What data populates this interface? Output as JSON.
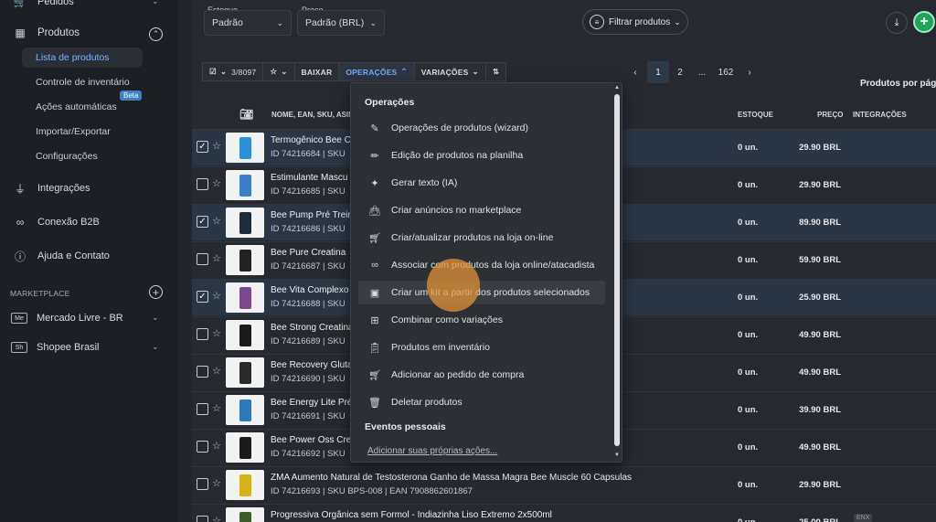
{
  "sidebar": {
    "top_item": "Pedidos",
    "produtos": "Produtos",
    "sub_items": [
      "Lista de produtos",
      "Controle de inventário",
      "Ações automáticas",
      "Importar/Exportar",
      "Configurações"
    ],
    "beta": "Beta",
    "integracoes": "Integrações",
    "conexao": "Conexão B2B",
    "ajuda": "Ajuda e Contato",
    "marketplace_title": "MARKETPLACE",
    "marketplaces": [
      {
        "badge": "Me",
        "label": "Mercado Livre - BR"
      },
      {
        "badge": "Sh",
        "label": "Shopee Brasil"
      }
    ]
  },
  "filters": {
    "estoque_label": "Estoque",
    "estoque_value": "Padrão",
    "preco_label": "Preço",
    "preco_value": "Padrão (BRL)",
    "filter_button": "Filtrar produtos"
  },
  "toolbar": {
    "selection": "3/8097",
    "baixar": "BAIXAR",
    "operacoes": "OPERAÇÕES",
    "variacoes": "VARIAÇÕES"
  },
  "pager": {
    "pages": [
      "1",
      "2",
      "...",
      "162"
    ],
    "per_page": "Produtos por pági"
  },
  "table": {
    "headers": {
      "name": "NOME, EAN, SKU, ASIN",
      "estoque": "ESTOQUE",
      "preco": "PREÇO",
      "integracoes": "INTEGRAÇÕES"
    },
    "rows": [
      {
        "name": "Termogênico Bee Co",
        "meta": "ID 74216684 | SKU",
        "stock": "0 un.",
        "price": "29.90 BRL",
        "selected": true,
        "color": "#2f8fd8"
      },
      {
        "name": "Estimulante Mascu",
        "meta": "ID 74216685 | SKU",
        "stock": "0 un.",
        "price": "29.90 BRL",
        "selected": false,
        "color": "#3a7fc7"
      },
      {
        "name": "Bee Pump Pré Trein",
        "meta": "ID 74216686 | SKU",
        "stock": "0 un.",
        "price": "89.90 BRL",
        "selected": true,
        "color": "#1d2b3a"
      },
      {
        "name": "Bee Pure Creatina",
        "meta": "ID 74216687 | SKU",
        "stock": "0 un.",
        "price": "59.90 BRL",
        "selected": false,
        "color": "#222222"
      },
      {
        "name": "Bee Vita Complexo",
        "meta": "ID 74216688 | SKU",
        "stock": "0 un.",
        "price": "25.90 BRL",
        "selected": true,
        "color": "#7a4a8a"
      },
      {
        "name": "Bee Strong Creatina",
        "meta": "ID 74216689 | SKU",
        "stock": "0 un.",
        "price": "49.90 BRL",
        "selected": false,
        "color": "#1a1a1a"
      },
      {
        "name": "Bee Recovery Gluta",
        "meta": "ID 74216690 | SKU",
        "stock": "0 un.",
        "price": "49.90 BRL",
        "selected": false,
        "color": "#2a2a2a"
      },
      {
        "name": "Bee Energy Lite Pré",
        "meta": "ID 74216691 | SKU",
        "stock": "0 un.",
        "price": "39.90 BRL",
        "selected": false,
        "color": "#2e7ab8"
      },
      {
        "name": "Bee Power Oss Cre",
        "meta": "ID 74216692 | SKU",
        "stock": "0 un.",
        "price": "49.90 BRL",
        "selected": false,
        "color": "#1b1b1b"
      },
      {
        "name": "ZMA Aumento Natural de Testosterona Ganho de Massa Magra Bee Muscle 60 Capsulas",
        "meta": "ID 74216693 | SKU BPS-008 | EAN 7908862601867",
        "stock": "0 un.",
        "price": "29.90 BRL",
        "selected": false,
        "color": "#d8b21a"
      },
      {
        "name": "Progressiva Orgânica sem Formol - Indiazinha Liso Extremo 2x500ml",
        "meta": "",
        "stock": "0 un.",
        "price": "25.00 BRL",
        "selected": false,
        "color": "#3c5a2a"
      }
    ]
  },
  "menu": {
    "section1": "Operações",
    "items": [
      {
        "icon": "pencil-icon",
        "label": "Operações de produtos (wizard)"
      },
      {
        "icon": "edit-icon",
        "label": "Edição de produtos na planilha"
      },
      {
        "icon": "sparkle-icon",
        "label": "Gerar texto (IA)"
      },
      {
        "icon": "bag-icon",
        "label": "Criar anúncios no marketplace"
      },
      {
        "icon": "cart-icon",
        "label": "Criar/atualizar produtos na loja on-line"
      },
      {
        "icon": "link-icon",
        "label": "Associar com produtos da loja online/atacadista"
      },
      {
        "icon": "kit-icon",
        "label": "Criar um kit a partir dos produtos selecionados"
      },
      {
        "icon": "grid-icon",
        "label": "Combinar como variações"
      },
      {
        "icon": "clipboard-icon",
        "label": "Produtos em inventário"
      },
      {
        "icon": "cart-add-icon",
        "label": "Adicionar ao pedido de compra"
      },
      {
        "icon": "trash-icon",
        "label": "Deletar produtos"
      }
    ],
    "section2": "Eventos pessoais",
    "link": "Adicionar suas próprias ações..."
  }
}
